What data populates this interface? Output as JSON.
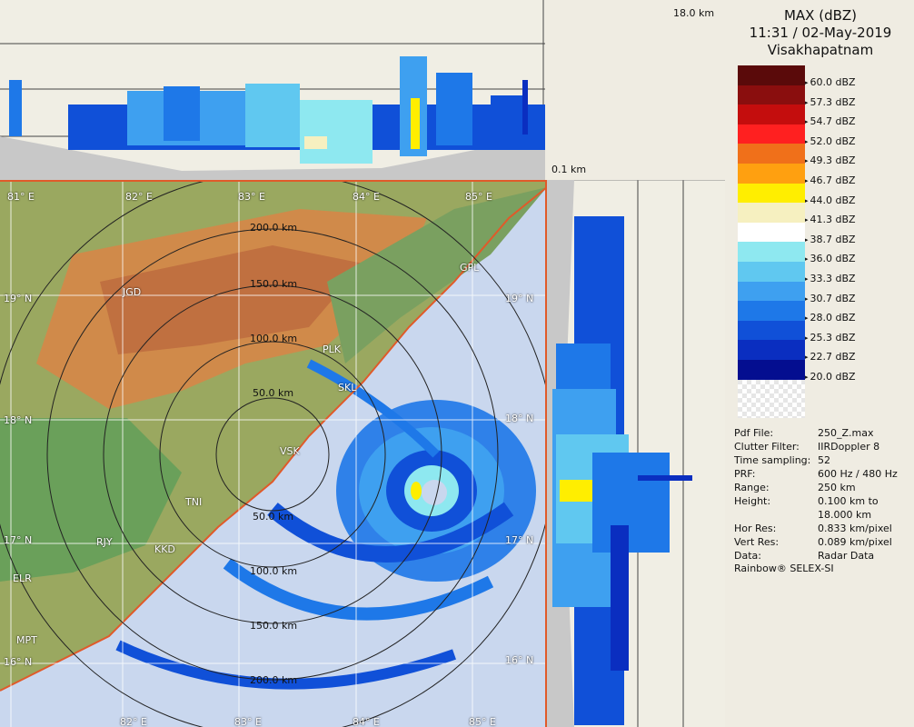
{
  "legend": {
    "title": "MAX (dBZ)",
    "datetime": "11:31 / 02-May-2019",
    "station": "Visakhapatnam",
    "scale": [
      {
        "label": "60.0 dBZ",
        "color": "#5a0a0a"
      },
      {
        "label": "57.3 dBZ",
        "color": "#8a0e0e"
      },
      {
        "label": "54.7 dBZ",
        "color": "#c40d0d"
      },
      {
        "label": "52.0 dBZ",
        "color": "#ff2020"
      },
      {
        "label": "49.3 dBZ",
        "color": "#f0701a"
      },
      {
        "label": "46.7 dBZ",
        "color": "#ffa010"
      },
      {
        "label": "44.0 dBZ",
        "color": "#ffee00"
      },
      {
        "label": "41.3 dBZ",
        "color": "#f6f0c0"
      },
      {
        "label": "38.7 dBZ",
        "color": "#ffffff"
      },
      {
        "label": "36.0 dBZ",
        "color": "#8ee8f0"
      },
      {
        "label": "33.3 dBZ",
        "color": "#60c8f0"
      },
      {
        "label": "30.7 dBZ",
        "color": "#3ea0f0"
      },
      {
        "label": "28.0 dBZ",
        "color": "#1e78e8"
      },
      {
        "label": "25.3 dBZ",
        "color": "#1050d8"
      },
      {
        "label": "22.7 dBZ",
        "color": "#0a2ec0"
      },
      {
        "label": "20.0 dBZ",
        "color": "#040e90"
      }
    ]
  },
  "info": [
    {
      "key": "Pdf File:",
      "value": "250_Z.max"
    },
    {
      "key": "Clutter Filter:",
      "value": "IIRDoppler 8"
    },
    {
      "key": "Time sampling:",
      "value": "52"
    },
    {
      "key": "PRF:",
      "value": "600 Hz / 480 Hz"
    },
    {
      "key": "Range:",
      "value": "250 km"
    },
    {
      "key": "Height:",
      "value": "0.100 km to"
    },
    {
      "key": "",
      "value": "18.000 km"
    },
    {
      "key": "Hor Res:",
      "value": "0.833 km/pixel"
    },
    {
      "key": "Vert Res:",
      "value": "0.089 km/pixel"
    },
    {
      "key": "Data:",
      "value": "Radar Data"
    }
  ],
  "credit": "Rainbow® SELEX-SI",
  "height_top": "18.0 km",
  "height_bottom": "0.1 km",
  "map": {
    "lon_labels": [
      "81° E",
      "82° E",
      "83° E",
      "84° E",
      "85° E"
    ],
    "lon_labels_bottom": [
      "82° E",
      "83° E",
      "84° E",
      "85° E"
    ],
    "lat_labels": [
      "19° N",
      "18° N",
      "17° N",
      "16° N"
    ],
    "lat_labels_right": [
      "19° N",
      "18° N",
      "17° N",
      "16° N"
    ],
    "rings_north": [
      "200.0 km",
      "150.0 km",
      "100.0 km",
      "50.0 km"
    ],
    "rings_south": [
      "50.0 km",
      "100.0 km",
      "150.0 km",
      "200.0 km"
    ],
    "cities": [
      "JGD",
      "PLK",
      "SKL",
      "VSK",
      "TNI",
      "RJY",
      "KKD",
      "ELR",
      "MPT",
      "GPL"
    ]
  }
}
